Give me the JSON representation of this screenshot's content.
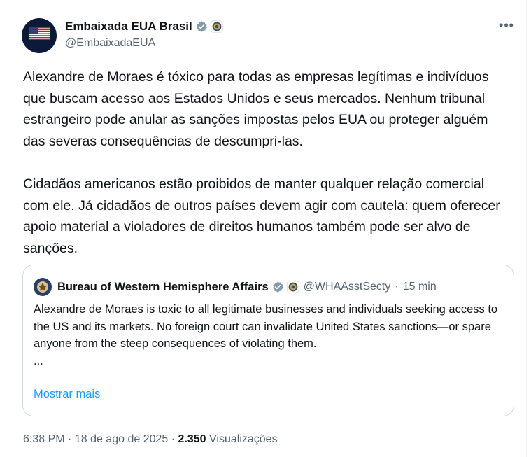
{
  "post": {
    "author": {
      "display_name": "Embaixada EUA Brasil",
      "handle": "@EmbaixadaEUA",
      "avatar_icon": "us-embassy-flag-avatar",
      "verified_icon": "verified-badge-icon",
      "affiliate_icon": "state-department-seal-icon"
    },
    "more_icon": "more-options-icon",
    "text": [
      "Alexandre de Moraes é tóxico para todas as empresas legítimas e indivíduos que buscam acesso aos Estados Unidos e seus mercados. Nenhum tribunal estrangeiro pode anular as sanções impostas pelos EUA ou proteger alguém das severas consequências de descumpri-las.",
      "Cidadãos americanos estão proibidos de manter qualquer relação comercial com ele. Já cidadãos de outros países devem agir com cautela: quem oferecer apoio material a violadores de direitos humanos também pode ser alvo de sanções."
    ],
    "quoted": {
      "display_name": "Bureau of Western Hemisphere Affairs",
      "handle": "@WHAAsstSecty",
      "separator": "·",
      "time": "15 min",
      "text": "Alexandre de Moraes is toxic to all legitimate businesses and individuals seeking access to the US and its markets. No foreign court can invalidate United States sanctions—or spare anyone from the steep consequences of violating them.",
      "ellipsis": "...",
      "show_more": "Mostrar mais"
    },
    "meta": {
      "time": "6:38 PM",
      "sep1": "·",
      "date": "18 de ago de 2025",
      "sep2": "·",
      "views_count": "2.350",
      "views_label": "Visualizações"
    }
  },
  "colors": {
    "text": "#0f1419",
    "secondary": "#536471",
    "link": "#1d9bf0",
    "verified": "#829aab",
    "border": "#cfd9de"
  }
}
